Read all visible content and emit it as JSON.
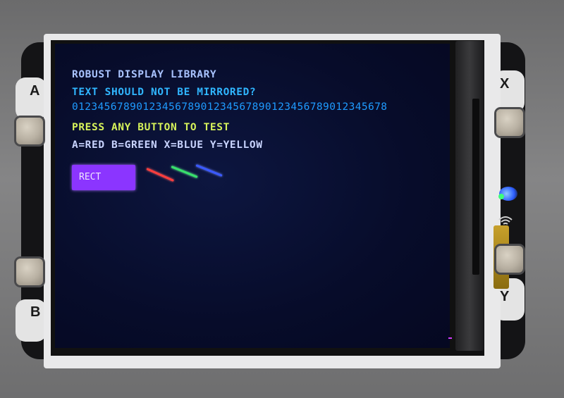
{
  "screen": {
    "lines": [
      "ROBUST DISPLAY LIBRARY",
      "TEXT SHOULD NOT BE MIRRORED?",
      "0123456789012345678901234567890123456789012345678",
      "PRESS ANY BUTTON TO TEST",
      "A=RED B=GREEN X=BLUE Y=YELLOW"
    ],
    "rect_label": "RECT",
    "colors": {
      "line1": "#a9c3ff",
      "line2": "#30b6ff",
      "line3": "#1f9bff",
      "line4": "#d6f25a",
      "line5": "#c9d4ff",
      "rect": "#8b35ff",
      "diag_red": "#ff3d3d",
      "diag_green": "#37e06b",
      "diag_blue": "#3a59ff"
    }
  },
  "buttons": {
    "a": "A",
    "b": "B",
    "x": "X",
    "y": "Y"
  },
  "icons": {
    "wifi": "wifi-icon"
  }
}
